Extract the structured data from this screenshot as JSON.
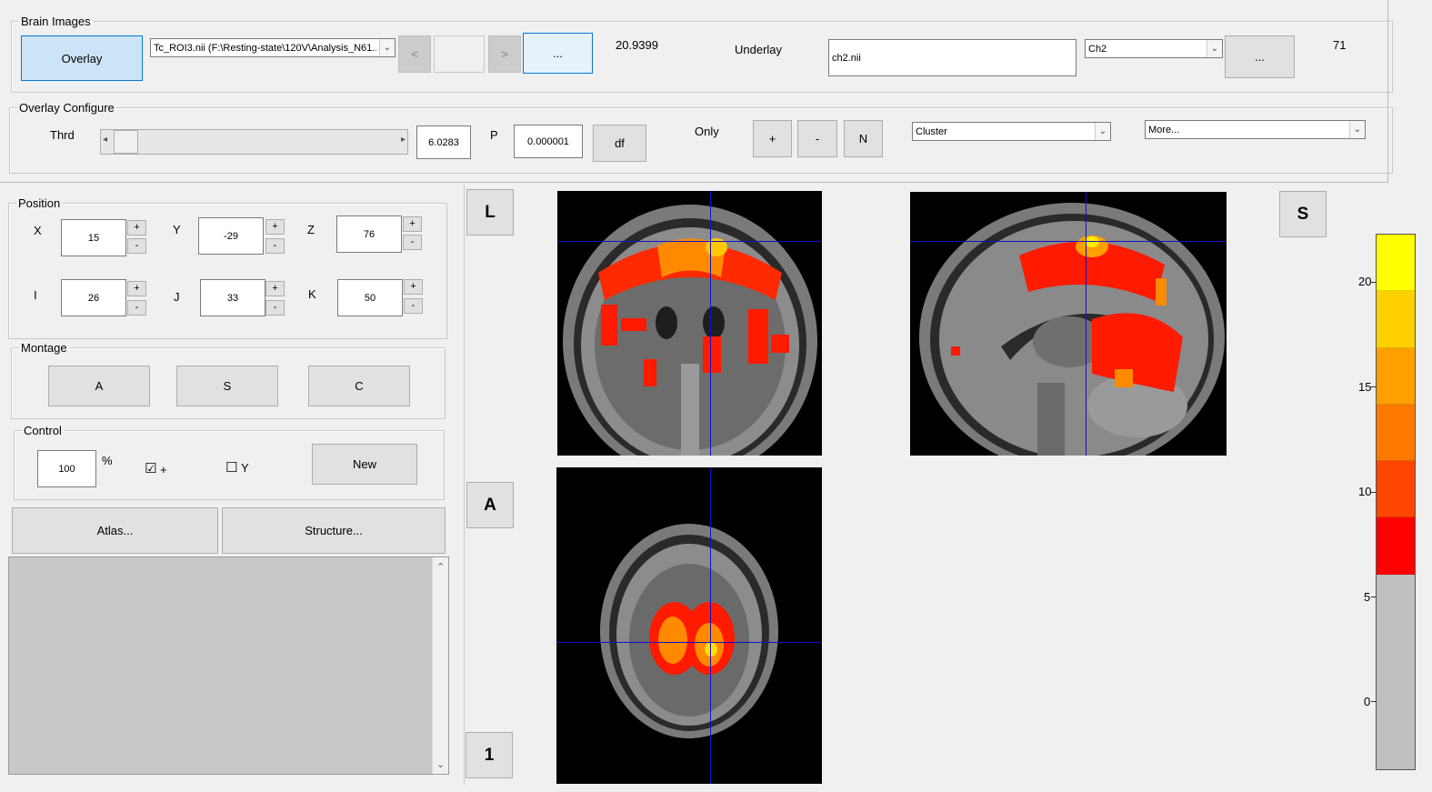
{
  "brain_images": {
    "legend": "Brain Images",
    "overlay_button": "Overlay",
    "overlay_file": "Tc_ROI3.nii (F:\\Resting-state\\120V\\Analysis_N61...",
    "prev_label": "<",
    "next_label": ">",
    "browse_overlay": "...",
    "overlay_max": "20.9399",
    "underlay_label": "Underlay",
    "underlay_file": "ch2.nii",
    "underlay_template": "Ch2",
    "browse_underlay": "...",
    "underlay_max": "71"
  },
  "overlay_configure": {
    "legend": "Overlay Configure",
    "thrd_label": "Thrd",
    "thrd_value": "6.0283",
    "p_label": "P",
    "p_value": "0.000001",
    "df_button": "df",
    "only_label": "Only",
    "plus_button": "+",
    "minus_button": "-",
    "n_button": "N",
    "cluster_select": "Cluster",
    "more_select": "More...",
    "slider_left_arrow": "◂",
    "slider_right_arrow": "▸"
  },
  "position": {
    "legend": "Position",
    "x_label": "X",
    "x_value": "15",
    "y_label": "Y",
    "y_value": "-29",
    "z_label": "Z",
    "z_value": "76",
    "i_label": "I",
    "i_value": "26",
    "j_label": "J",
    "j_value": "33",
    "k_label": "K",
    "k_value": "50",
    "inc": "+",
    "dec": "-"
  },
  "montage": {
    "legend": "Montage",
    "a_button": "A",
    "s_button": "S",
    "c_button": "C"
  },
  "control": {
    "legend": "Control",
    "zoom_value": "100",
    "percent": "%",
    "crosshair_check": "☑",
    "crosshair_label": "+",
    "y_check": "☐",
    "y_label": "Y",
    "new_button": "New"
  },
  "atlas_button": "Atlas...",
  "structure_button": "Structure...",
  "scroll_up": "⌃",
  "scroll_down": "⌄",
  "view_buttons": {
    "l": "L",
    "a": "A",
    "one": "1",
    "s": "S"
  },
  "colorbar": {
    "ticks": [
      "20",
      "15",
      "10",
      "5",
      "0"
    ],
    "colors": [
      "#ffff00",
      "#ffd000",
      "#ffa000",
      "#ff7800",
      "#ff4600",
      "#ff0000",
      "#c0c0c0"
    ]
  },
  "colors": {
    "accent_blue": "#cce4f7",
    "crosshair": "#1010c8"
  }
}
